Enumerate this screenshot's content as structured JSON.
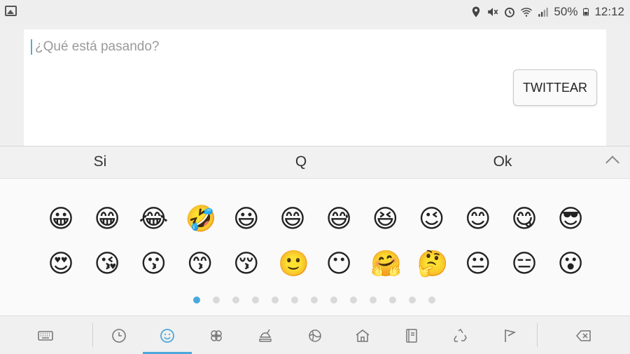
{
  "status_bar": {
    "battery_percent": "50%",
    "time": "12:12",
    "icons": [
      "gallery-icon",
      "location-icon",
      "mute-icon",
      "alarm-icon",
      "wifi-icon",
      "signal-icon",
      "battery-icon"
    ]
  },
  "compose": {
    "placeholder": "¿Qué está pasando?",
    "tweet_button": "TWITTEAR"
  },
  "suggestions": [
    "Si",
    "Q",
    "Ok"
  ],
  "emoji_rows": [
    [
      "😀",
      "😁",
      "😂",
      "🤣",
      "😃",
      "😄",
      "😅",
      "😆",
      "😉",
      "😊",
      "😋",
      "😎"
    ],
    [
      "😍",
      "😘",
      "😗",
      "😙",
      "😚",
      "🙂",
      "😶",
      "🤗",
      "🤔",
      "😐",
      "😑",
      "😮"
    ]
  ],
  "pagination": {
    "total": 13,
    "active": 0
  },
  "categories": [
    {
      "name": "keyboard-icon"
    },
    {
      "name": "recent-icon"
    },
    {
      "name": "smiley-icon",
      "active": true
    },
    {
      "name": "clover-icon"
    },
    {
      "name": "food-icon"
    },
    {
      "name": "sports-icon"
    },
    {
      "name": "house-icon"
    },
    {
      "name": "notebook-icon"
    },
    {
      "name": "recycle-icon"
    },
    {
      "name": "flag-icon"
    },
    {
      "name": "backspace-icon"
    }
  ],
  "colors": {
    "accent": "#4aa8dc",
    "panel": "#fafafa",
    "bar": "#f0f0f0"
  }
}
